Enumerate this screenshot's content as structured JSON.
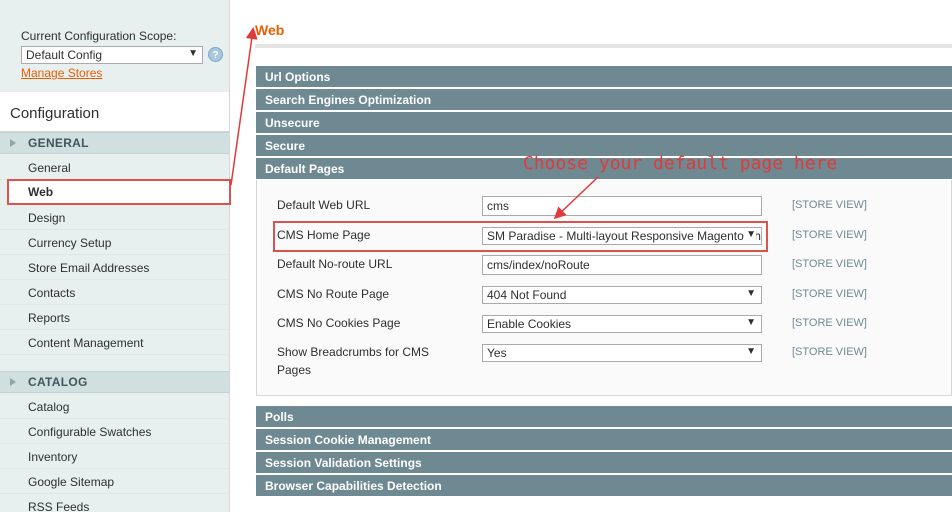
{
  "sidebar": {
    "scope_label": "Current Configuration Scope:",
    "scope_value": "Default Config",
    "manage_stores": "Manage Stores",
    "config_title": "Configuration",
    "general_group": "GENERAL",
    "general_items": [
      "General",
      "Web",
      "Design",
      "Currency Setup",
      "Store Email Addresses",
      "Contacts",
      "Reports",
      "Content Management"
    ],
    "catalog_group": "CATALOG",
    "catalog_items": [
      "Catalog",
      "Configurable Swatches",
      "Inventory",
      "Google Sitemap",
      "RSS Feeds"
    ],
    "active_item": "Web"
  },
  "main": {
    "title": "Web",
    "sections_top": [
      "Url Options",
      "Search Engines Optimization",
      "Unsecure",
      "Secure",
      "Default Pages"
    ],
    "sections_bottom": [
      "Polls",
      "Session Cookie Management",
      "Session Validation Settings",
      "Browser Capabilities Detection"
    ],
    "annotation": "Choose your default page here",
    "fields": {
      "default_web_url": {
        "label": "Default Web URL",
        "value": "cms",
        "scope": "[STORE VIEW]"
      },
      "cms_home_page": {
        "label": "CMS Home Page",
        "value": "SM Paradise - Multi-layout Responsive Magento Theme",
        "scope": "[STORE VIEW]"
      },
      "default_noroute_url": {
        "label": "Default No-route URL",
        "value": "cms/index/noRoute",
        "scope": "[STORE VIEW]"
      },
      "cms_noroute_page": {
        "label": "CMS No Route Page",
        "value": "404 Not Found",
        "scope": "[STORE VIEW]"
      },
      "cms_nocookies_page": {
        "label": "CMS No Cookies Page",
        "value": "Enable Cookies",
        "scope": "[STORE VIEW]"
      },
      "show_breadcrumbs": {
        "label": "Show Breadcrumbs for CMS Pages",
        "value": "Yes",
        "scope": "[STORE VIEW]"
      }
    }
  },
  "colors": {
    "accent": "#eb5e00",
    "section_bar": "#6f8992",
    "highlight": "#d9534f",
    "annotation": "#e03a3a"
  },
  "icons": {
    "help": "help-icon",
    "dropdown": "chevron-down-icon",
    "group_toggle": "triangle-right-icon"
  }
}
